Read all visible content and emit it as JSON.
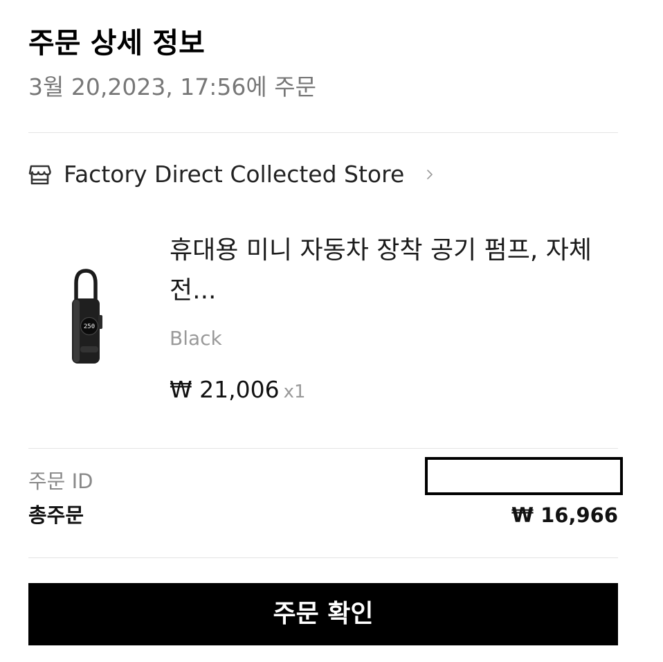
{
  "header": {
    "title": "주문 상세 정보",
    "order_date": "3월 20,2023, 17:56에 주문"
  },
  "store": {
    "name": "Factory Direct Collected Store",
    "icon": "store-icon",
    "chevron_icon": "chevron-right-icon"
  },
  "product": {
    "title": "휴대용 미니 자동차 장착 공기 펌프, 자체 전...",
    "variant": "Black",
    "price": "₩ 21,006",
    "quantity": "x1",
    "image_icon": "portable-air-pump-image",
    "display_reading": "250"
  },
  "summary": {
    "order_id_label": "주문 ID",
    "order_id_value": "",
    "total_label": "총주문",
    "total_value": "₩ 16,966"
  },
  "actions": {
    "confirm_label": "주문 확인"
  },
  "colors": {
    "text_primary": "#111111",
    "text_secondary": "#777777",
    "text_muted": "#999999",
    "divider": "#e4e4e4",
    "button_bg": "#000000",
    "button_text": "#ffffff"
  }
}
